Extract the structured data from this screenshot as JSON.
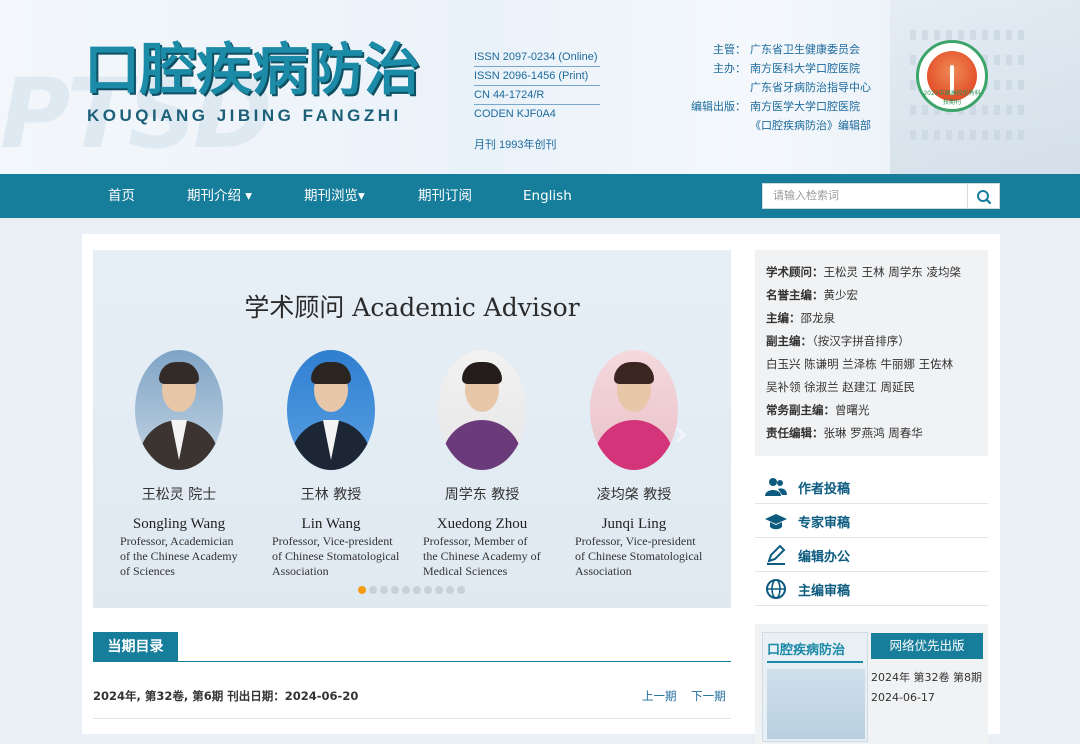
{
  "header": {
    "watermark": "PTSD",
    "title_cn": "口腔疾病防治",
    "title_en": "KOUQIANG JIBING FANGZHI",
    "issn_lines": [
      "ISSN 2097-0234 (Online)",
      "ISSN 2096-1456 (Print)",
      "CN 44-1724/R",
      "CODEN KJF0A4"
    ],
    "frequency": "月刊    1993年创刊",
    "sponsor": [
      {
        "label": "主管：",
        "value": "广东省卫生健康委员会"
      },
      {
        "label": "主办：",
        "value": "南方医科大学口腔医院"
      },
      {
        "label": "",
        "value": "广东省牙病防治指导中心"
      },
      {
        "label": "编辑出版：",
        "value": "南方医学大学口腔医院"
      },
      {
        "label": "",
        "value": "《口腔疾病防治》编辑部"
      }
    ],
    "badge_text": "2022中国高校优秀科技期刊"
  },
  "nav": {
    "items": [
      "首页",
      "期刊介绍 ▾",
      "期刊浏览▾",
      "期刊订阅",
      "English"
    ],
    "search_placeholder": "请输入检索词"
  },
  "slider": {
    "title": "学术顾问 Academic Advisor",
    "people": [
      {
        "cn": "王松灵 院士",
        "en": "Songling Wang",
        "desc": [
          "Professor, Academician",
          "of the Chinese Academy",
          "of Sciences"
        ]
      },
      {
        "cn": "王林 教授",
        "en": "Lin Wang",
        "desc": [
          "Professor, Vice-president",
          "of Chinese Stomatological",
          "Association"
        ]
      },
      {
        "cn": "周学东 教授",
        "en": "Xuedong Zhou",
        "desc": [
          "Professor, Member of",
          "the Chinese Academy of",
          "Medical Sciences"
        ]
      },
      {
        "cn": "凌均棨 教授",
        "en": "Junqi Ling",
        "desc": [
          "Professor, Vice-president",
          "of Chinese Stomatological",
          "Association"
        ]
      }
    ],
    "dot_count": 10,
    "active_dot": 1
  },
  "editors": [
    {
      "label": "学术顾问：",
      "value": "王松灵 王林 周学东 凌均棨"
    },
    {
      "label": "名誉主编：",
      "value": "黄少宏"
    },
    {
      "label": "主编：",
      "value": "邵龙泉"
    },
    {
      "label": "副主编：",
      "value": "（按汉字拼音排序）"
    },
    {
      "label": "",
      "value": "白玉兴 陈谦明 兰泽栋 牛丽娜 王佐林"
    },
    {
      "label": "",
      "value": "吴补领 徐淑兰 赵建江 周延民"
    },
    {
      "label": "常务副主编：",
      "value": "曾曙光"
    },
    {
      "label": "责任编辑：",
      "value": "张琳   罗燕鸿   周春华"
    }
  ],
  "actions": [
    {
      "label": "作者投稿",
      "icon": "users-icon"
    },
    {
      "label": "专家审稿",
      "icon": "graduation-cap-icon"
    },
    {
      "label": "编辑办公",
      "icon": "pencil-icon"
    },
    {
      "label": "主编审稿",
      "icon": "globe-icon"
    }
  ],
  "online_first": {
    "label": "网络优先出版",
    "cover_title": "口腔疾病防治",
    "issue": "2024年 第32卷 第8期",
    "date": "2024-06-17"
  },
  "current_issue": {
    "tab": "当期目录",
    "info": "2024年, 第32卷, 第6期    刊出日期：2024-06-20",
    "prev": "上一期",
    "next": "下一期"
  },
  "colors": {
    "nav": "#167d9b",
    "accent_text": "#0d5c80",
    "active_dot": "#f39c12"
  }
}
